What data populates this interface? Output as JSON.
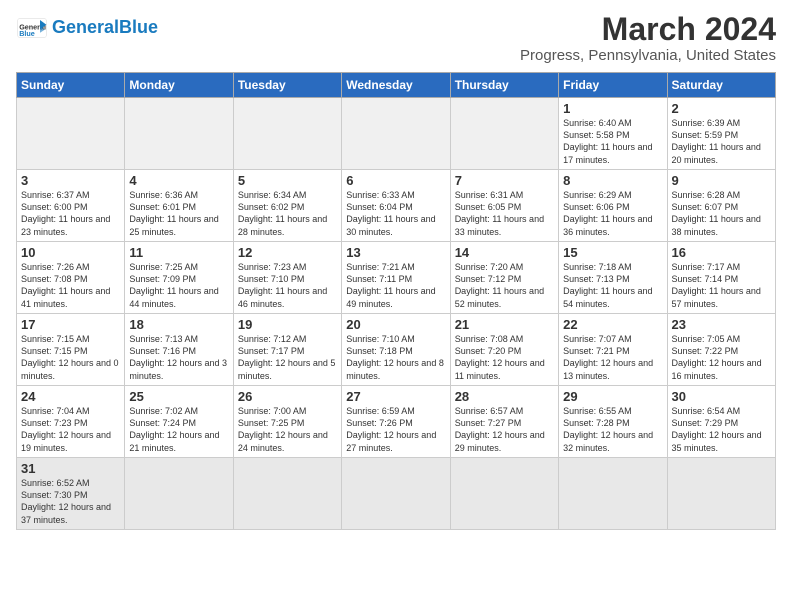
{
  "header": {
    "logo_general": "General",
    "logo_blue": "Blue",
    "title": "March 2024",
    "subtitle": "Progress, Pennsylvania, United States"
  },
  "days_of_week": [
    "Sunday",
    "Monday",
    "Tuesday",
    "Wednesday",
    "Thursday",
    "Friday",
    "Saturday"
  ],
  "weeks": [
    [
      {
        "day": "",
        "info": ""
      },
      {
        "day": "",
        "info": ""
      },
      {
        "day": "",
        "info": ""
      },
      {
        "day": "",
        "info": ""
      },
      {
        "day": "",
        "info": ""
      },
      {
        "day": "1",
        "info": "Sunrise: 6:40 AM\nSunset: 5:58 PM\nDaylight: 11 hours\nand 17 minutes."
      },
      {
        "day": "2",
        "info": "Sunrise: 6:39 AM\nSunset: 5:59 PM\nDaylight: 11 hours\nand 20 minutes."
      }
    ],
    [
      {
        "day": "3",
        "info": "Sunrise: 6:37 AM\nSunset: 6:00 PM\nDaylight: 11 hours\nand 23 minutes."
      },
      {
        "day": "4",
        "info": "Sunrise: 6:36 AM\nSunset: 6:01 PM\nDaylight: 11 hours\nand 25 minutes."
      },
      {
        "day": "5",
        "info": "Sunrise: 6:34 AM\nSunset: 6:02 PM\nDaylight: 11 hours\nand 28 minutes."
      },
      {
        "day": "6",
        "info": "Sunrise: 6:33 AM\nSunset: 6:04 PM\nDaylight: 11 hours\nand 30 minutes."
      },
      {
        "day": "7",
        "info": "Sunrise: 6:31 AM\nSunset: 6:05 PM\nDaylight: 11 hours\nand 33 minutes."
      },
      {
        "day": "8",
        "info": "Sunrise: 6:29 AM\nSunset: 6:06 PM\nDaylight: 11 hours\nand 36 minutes."
      },
      {
        "day": "9",
        "info": "Sunrise: 6:28 AM\nSunset: 6:07 PM\nDaylight: 11 hours\nand 38 minutes."
      }
    ],
    [
      {
        "day": "10",
        "info": "Sunrise: 7:26 AM\nSunset: 7:08 PM\nDaylight: 11 hours\nand 41 minutes."
      },
      {
        "day": "11",
        "info": "Sunrise: 7:25 AM\nSunset: 7:09 PM\nDaylight: 11 hours\nand 44 minutes."
      },
      {
        "day": "12",
        "info": "Sunrise: 7:23 AM\nSunset: 7:10 PM\nDaylight: 11 hours\nand 46 minutes."
      },
      {
        "day": "13",
        "info": "Sunrise: 7:21 AM\nSunset: 7:11 PM\nDaylight: 11 hours\nand 49 minutes."
      },
      {
        "day": "14",
        "info": "Sunrise: 7:20 AM\nSunset: 7:12 PM\nDaylight: 11 hours\nand 52 minutes."
      },
      {
        "day": "15",
        "info": "Sunrise: 7:18 AM\nSunset: 7:13 PM\nDaylight: 11 hours\nand 54 minutes."
      },
      {
        "day": "16",
        "info": "Sunrise: 7:17 AM\nSunset: 7:14 PM\nDaylight: 11 hours\nand 57 minutes."
      }
    ],
    [
      {
        "day": "17",
        "info": "Sunrise: 7:15 AM\nSunset: 7:15 PM\nDaylight: 12 hours\nand 0 minutes."
      },
      {
        "day": "18",
        "info": "Sunrise: 7:13 AM\nSunset: 7:16 PM\nDaylight: 12 hours\nand 3 minutes."
      },
      {
        "day": "19",
        "info": "Sunrise: 7:12 AM\nSunset: 7:17 PM\nDaylight: 12 hours\nand 5 minutes."
      },
      {
        "day": "20",
        "info": "Sunrise: 7:10 AM\nSunset: 7:18 PM\nDaylight: 12 hours\nand 8 minutes."
      },
      {
        "day": "21",
        "info": "Sunrise: 7:08 AM\nSunset: 7:20 PM\nDaylight: 12 hours\nand 11 minutes."
      },
      {
        "day": "22",
        "info": "Sunrise: 7:07 AM\nSunset: 7:21 PM\nDaylight: 12 hours\nand 13 minutes."
      },
      {
        "day": "23",
        "info": "Sunrise: 7:05 AM\nSunset: 7:22 PM\nDaylight: 12 hours\nand 16 minutes."
      }
    ],
    [
      {
        "day": "24",
        "info": "Sunrise: 7:04 AM\nSunset: 7:23 PM\nDaylight: 12 hours\nand 19 minutes."
      },
      {
        "day": "25",
        "info": "Sunrise: 7:02 AM\nSunset: 7:24 PM\nDaylight: 12 hours\nand 21 minutes."
      },
      {
        "day": "26",
        "info": "Sunrise: 7:00 AM\nSunset: 7:25 PM\nDaylight: 12 hours\nand 24 minutes."
      },
      {
        "day": "27",
        "info": "Sunrise: 6:59 AM\nSunset: 7:26 PM\nDaylight: 12 hours\nand 27 minutes."
      },
      {
        "day": "28",
        "info": "Sunrise: 6:57 AM\nSunset: 7:27 PM\nDaylight: 12 hours\nand 29 minutes."
      },
      {
        "day": "29",
        "info": "Sunrise: 6:55 AM\nSunset: 7:28 PM\nDaylight: 12 hours\nand 32 minutes."
      },
      {
        "day": "30",
        "info": "Sunrise: 6:54 AM\nSunset: 7:29 PM\nDaylight: 12 hours\nand 35 minutes."
      }
    ],
    [
      {
        "day": "31",
        "info": "Sunrise: 6:52 AM\nSunset: 7:30 PM\nDaylight: 12 hours\nand 37 minutes."
      },
      {
        "day": "",
        "info": ""
      },
      {
        "day": "",
        "info": ""
      },
      {
        "day": "",
        "info": ""
      },
      {
        "day": "",
        "info": ""
      },
      {
        "day": "",
        "info": ""
      },
      {
        "day": "",
        "info": ""
      }
    ]
  ]
}
